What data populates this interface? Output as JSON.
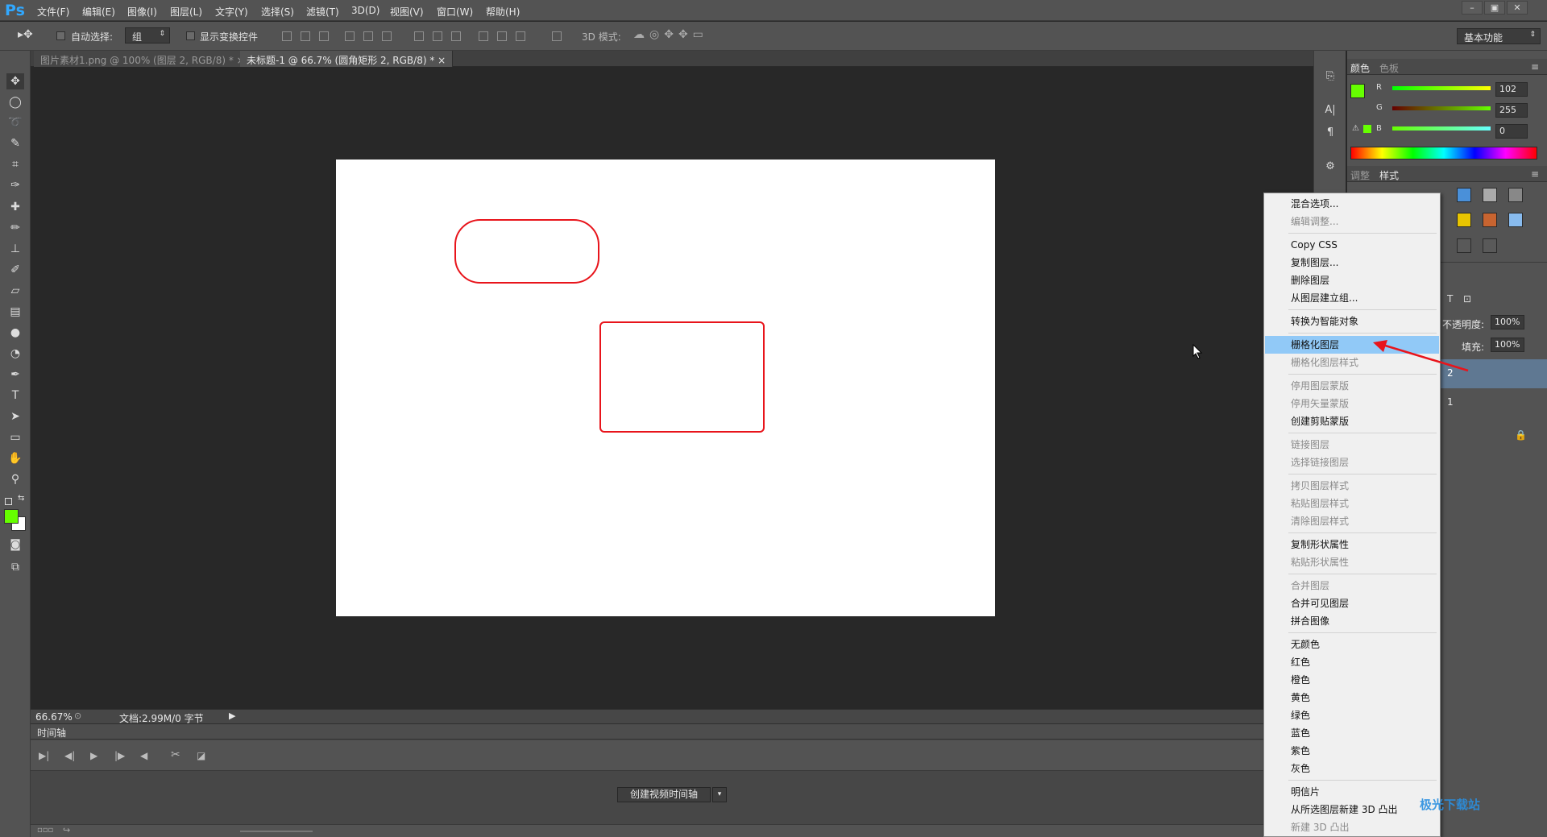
{
  "app": {
    "logo": "Ps"
  },
  "menu": [
    "文件(F)",
    "编辑(E)",
    "图像(I)",
    "图层(L)",
    "文字(Y)",
    "选择(S)",
    "滤镜(T)",
    "3D(D)",
    "视图(V)",
    "窗口(W)",
    "帮助(H)"
  ],
  "window_controls": [
    "–",
    "▣",
    "✕"
  ],
  "options": {
    "auto_select": "自动选择:",
    "group_value": "组",
    "show_transform": "显示变换控件",
    "mode_3d": "3D 模式:",
    "workspace": "基本功能"
  },
  "tabs": [
    {
      "label": "图片素材1.png @ 100% (图层 2, RGB/8) *",
      "close": "×"
    },
    {
      "label": "未标题-1 @ 66.7% (圆角矩形 2, RGB/8) *",
      "close": "×"
    }
  ],
  "status": {
    "zoom": "66.67%",
    "doc": "文档:2.99M/0 字节"
  },
  "timeline": {
    "tab": "时间轴",
    "create_button": "创建视频时间轴",
    "dropdown": "▾"
  },
  "color_panel": {
    "tabs": [
      "颜色",
      "色板"
    ],
    "labels": [
      "R",
      "G",
      "B"
    ],
    "values": [
      "102",
      "255",
      "0"
    ],
    "foreground": "#66ff00"
  },
  "styles_panel": {
    "tabs": [
      "调整",
      "样式"
    ]
  },
  "layers_panel": {
    "opacity_label": "不透明度:",
    "opacity_value": "100%",
    "fill_label": "填充:",
    "fill_value": "100%",
    "layer2": "2",
    "layer1": "1"
  },
  "context_menu": {
    "items": [
      {
        "label": "混合选项...",
        "disabled": false
      },
      {
        "label": "编辑调整...",
        "disabled": true
      },
      {
        "label": "Copy CSS",
        "disabled": false
      },
      {
        "label": "复制图层...",
        "disabled": false
      },
      {
        "label": "删除图层",
        "disabled": false
      },
      {
        "label": "从图层建立组...",
        "disabled": false
      },
      {
        "label": "转换为智能对象",
        "disabled": false
      },
      {
        "label": "栅格化图层",
        "disabled": false,
        "highlighted": true
      },
      {
        "label": "栅格化图层样式",
        "disabled": true
      },
      {
        "label": "停用图层蒙版",
        "disabled": true
      },
      {
        "label": "停用矢量蒙版",
        "disabled": true
      },
      {
        "label": "创建剪贴蒙版",
        "disabled": false
      },
      {
        "label": "链接图层",
        "disabled": true
      },
      {
        "label": "选择链接图层",
        "disabled": true
      },
      {
        "label": "拷贝图层样式",
        "disabled": true
      },
      {
        "label": "粘贴图层样式",
        "disabled": true
      },
      {
        "label": "清除图层样式",
        "disabled": true
      },
      {
        "label": "复制形状属性",
        "disabled": false
      },
      {
        "label": "粘贴形状属性",
        "disabled": true
      },
      {
        "label": "合并图层",
        "disabled": true
      },
      {
        "label": "合并可见图层",
        "disabled": false
      },
      {
        "label": "拼合图像",
        "disabled": false
      },
      {
        "label": "无颜色",
        "disabled": false
      },
      {
        "label": "红色",
        "disabled": false
      },
      {
        "label": "橙色",
        "disabled": false
      },
      {
        "label": "黄色",
        "disabled": false
      },
      {
        "label": "绿色",
        "disabled": false
      },
      {
        "label": "蓝色",
        "disabled": false
      },
      {
        "label": "紫色",
        "disabled": false
      },
      {
        "label": "灰色",
        "disabled": false
      },
      {
        "label": "明信片",
        "disabled": false
      },
      {
        "label": "从所选图层新建 3D 凸出",
        "disabled": false
      },
      {
        "label": "新建 3D 凸出",
        "disabled": true
      }
    ]
  },
  "watermark": "极光下载站",
  "colors": {
    "shape_stroke": "#e8141b",
    "highlight": "#91c9f7",
    "arrow": "#e8141b"
  }
}
